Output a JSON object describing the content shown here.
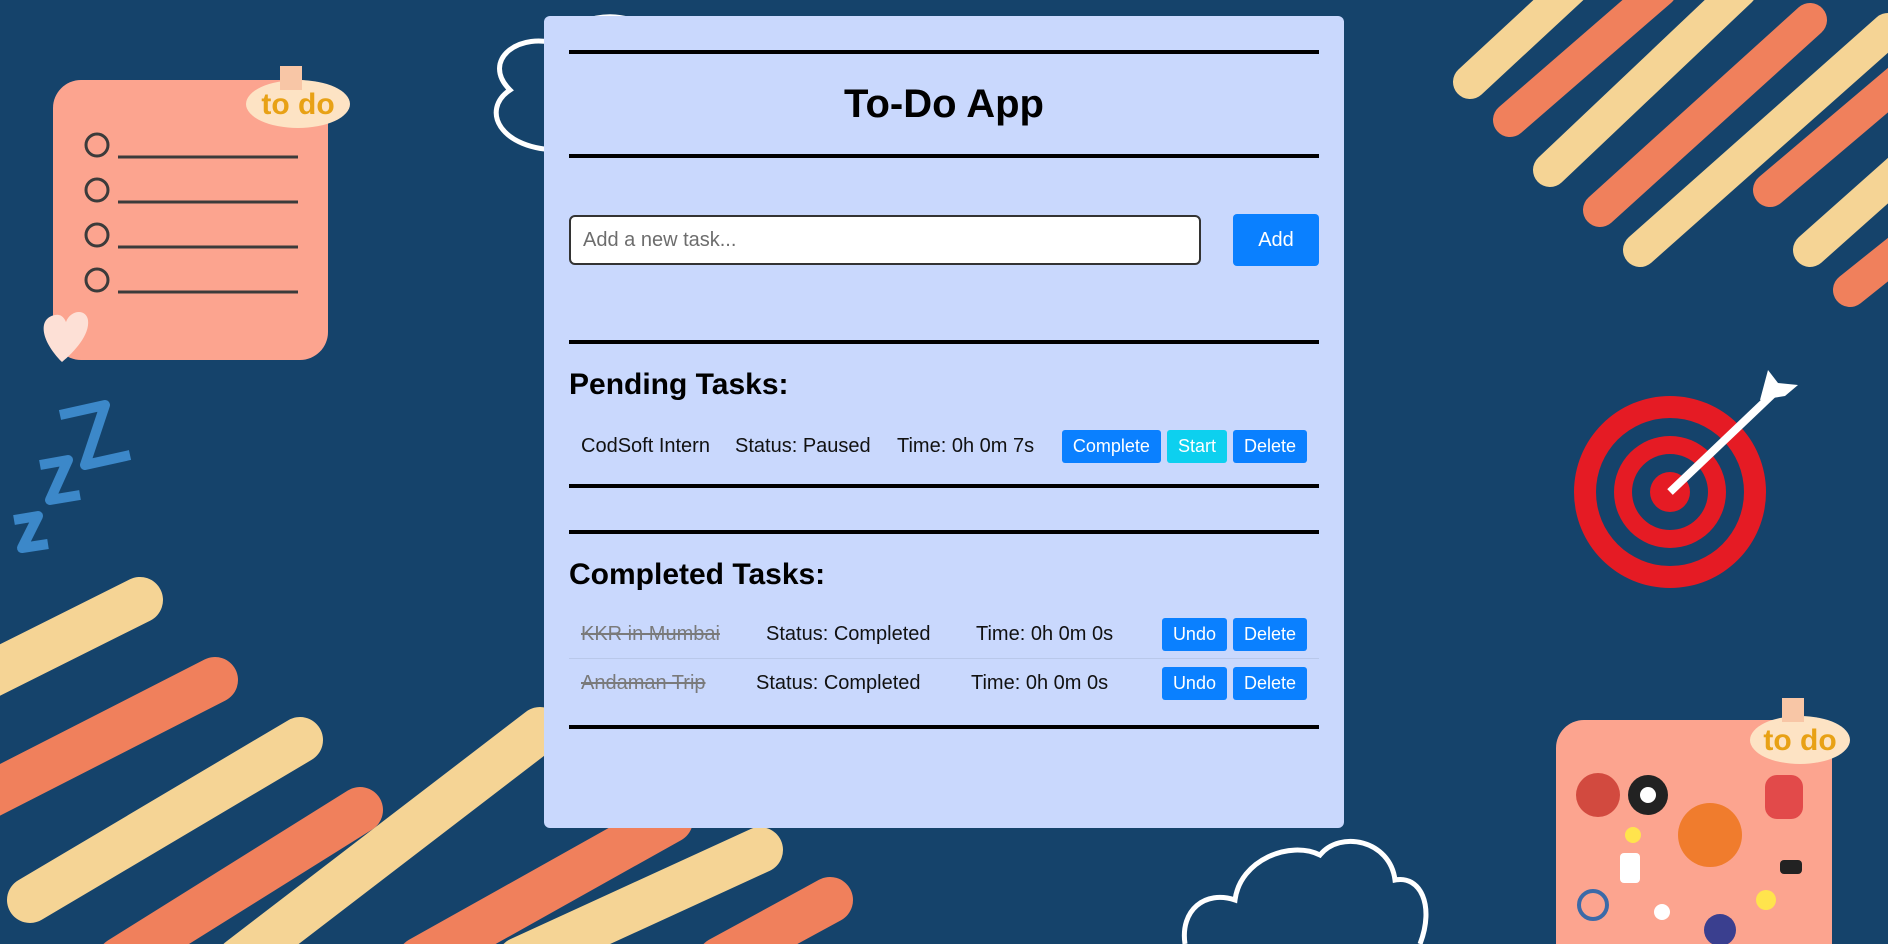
{
  "app": {
    "title": "To-Do App"
  },
  "input": {
    "placeholder": "Add a new task...",
    "value": "",
    "add_label": "Add"
  },
  "pending": {
    "heading": "Pending Tasks:",
    "tasks": [
      {
        "name": "CodSoft Intern",
        "status": "Status: Paused",
        "time": "Time: 0h 0m 7s",
        "complete_label": "Complete",
        "start_label": "Start",
        "delete_label": "Delete"
      }
    ]
  },
  "completed": {
    "heading": "Completed Tasks:",
    "tasks": [
      {
        "name": "KKR in Mumbai",
        "status": "Status: Completed",
        "time": "Time: 0h 0m 0s",
        "undo_label": "Undo",
        "delete_label": "Delete"
      },
      {
        "name": "Andaman Trip",
        "status": "Status: Completed",
        "time": "Time: 0h 0m 0s",
        "undo_label": "Undo",
        "delete_label": "Delete"
      }
    ]
  },
  "decor": {
    "sticker_text": "to do",
    "colors": {
      "background": "#15436b",
      "card": "#c9d8fd",
      "primary_button": "#0a80ff",
      "start_button": "#0dd0ef",
      "stripe_yellow": "#f5d495",
      "stripe_orange": "#f0805c",
      "note_pink": "#fca48f",
      "target_red": "#e51b24"
    }
  }
}
